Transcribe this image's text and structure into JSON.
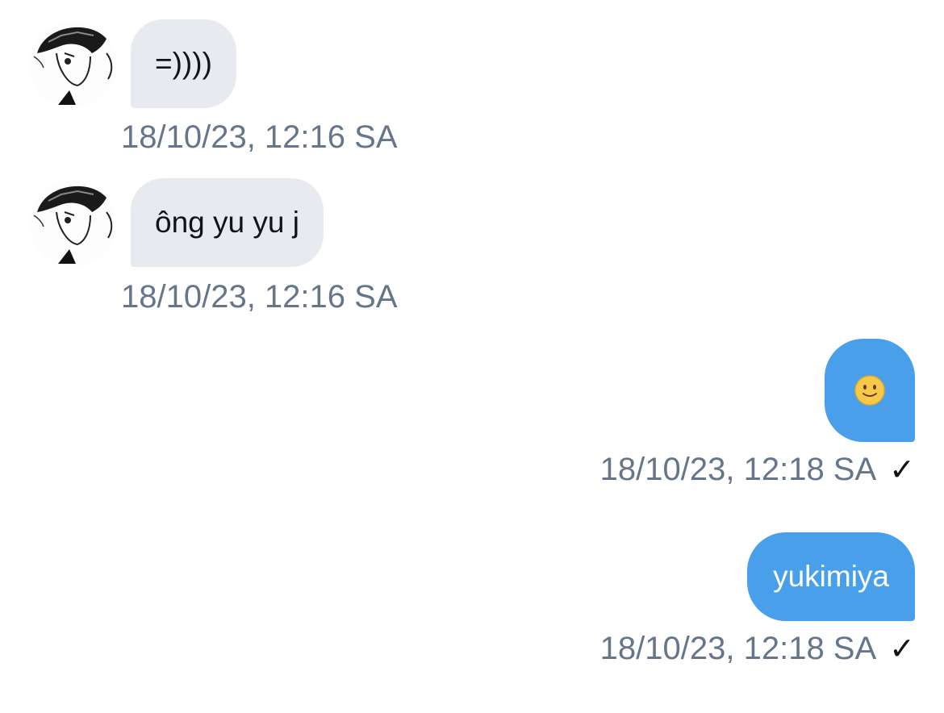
{
  "messages": [
    {
      "direction": "incoming",
      "text": "=))))",
      "timestamp": "18/10/23, 12:16 SA"
    },
    {
      "direction": "incoming",
      "text": "ông yu yu j",
      "timestamp": "18/10/23, 12:16 SA"
    },
    {
      "direction": "outgoing",
      "emoji": "slightly-smiling-face-emoji",
      "timestamp": "18/10/23, 12:18 SA",
      "status_icon": "check-icon",
      "status_glyph": "✓"
    },
    {
      "direction": "outgoing",
      "text": "yukimiya",
      "timestamp": "18/10/23, 12:18 SA",
      "status_icon": "check-icon",
      "status_glyph": "✓"
    }
  ],
  "colors": {
    "incoming_bubble": "#e7ebef",
    "outgoing_bubble": "#4a9fea",
    "timestamp": "#66768a",
    "text_dark": "#0f1419"
  },
  "icons": {
    "avatar": "manga-avatar-image"
  }
}
